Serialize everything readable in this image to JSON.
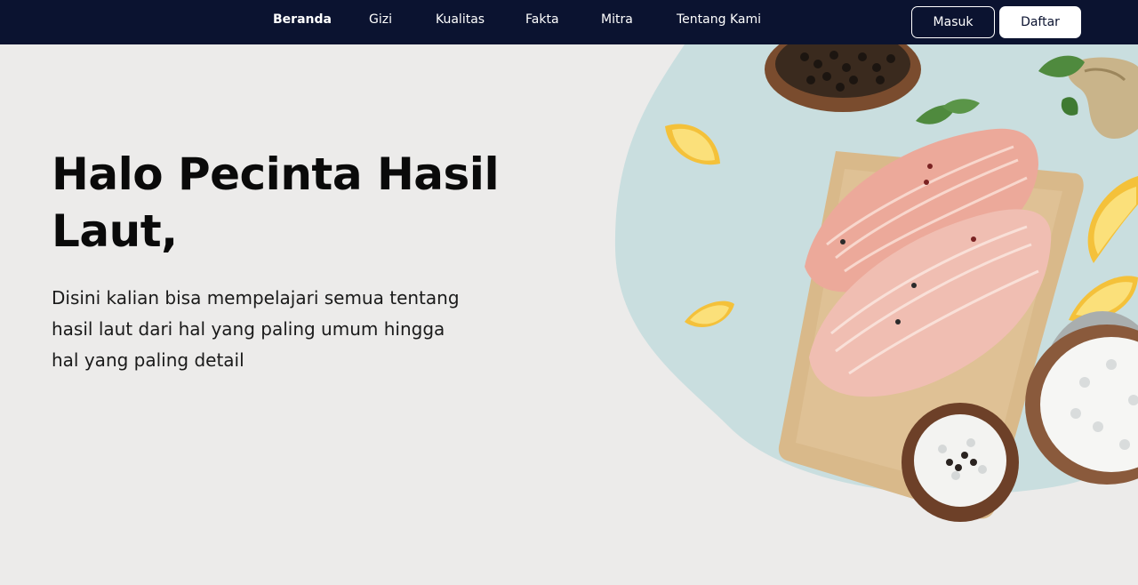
{
  "nav": {
    "links": [
      {
        "label": "Beranda",
        "active": true
      },
      {
        "label": "Gizi",
        "active": false
      },
      {
        "label": "Kualitas",
        "active": false
      },
      {
        "label": "Fakta",
        "active": false
      },
      {
        "label": "Mitra",
        "active": false
      },
      {
        "label": "Tentang Kami",
        "active": false
      }
    ],
    "login_label": "Masuk",
    "register_label": "Daftar"
  },
  "hero": {
    "title": "Halo Pecinta Hasil Laut,",
    "description": "Disini kalian bisa mempelajari semua tentang hasil laut dari hal yang paling umum hingga hal yang paling detail"
  },
  "colors": {
    "navbar": "#0b1330",
    "background": "#ecebea",
    "blob": "#c9dedf"
  },
  "illustration": {
    "items": [
      "fish-fillet-icon",
      "cutting-board-icon",
      "lemon-slice-icon",
      "peppercorn-bowl-icon",
      "salt-bowl-icon",
      "ginger-icon",
      "herb-leaf-icon"
    ]
  }
}
